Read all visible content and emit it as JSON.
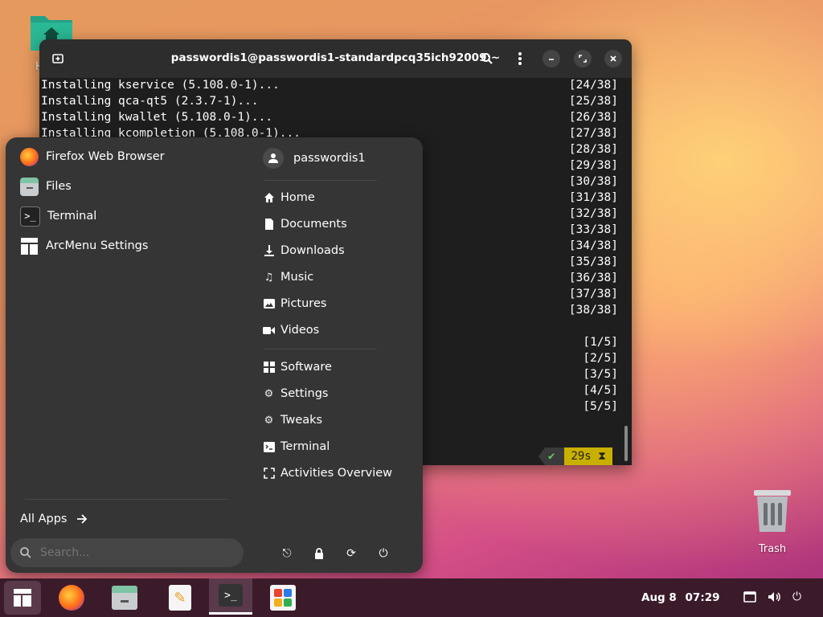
{
  "desktop": {
    "home_label": "H",
    "trash_label": "Trash"
  },
  "terminal": {
    "title": "passwordis1@passwordis1-standardpcq35ich92009:~",
    "lines": [
      "Installing kservice (5.108.0-1)...",
      "Installing qca-qt5 (2.3.7-1)...",
      "Installing kwallet (5.108.0-1)...",
      "Installing kcompletion (5.108.0-1)..."
    ],
    "counters": [
      "[24/38]",
      "[25/38]",
      "[26/38]",
      "[27/38]",
      "[28/38]",
      "[29/38]",
      "[30/38]",
      "[31/38]",
      "[32/38]",
      "[33/38]",
      "[34/38]",
      "[35/38]",
      "[36/38]",
      "[37/38]",
      "[38/38]"
    ],
    "counters2": [
      "[1/5]",
      "[2/5]",
      "[3/5]",
      "[4/5]",
      "[5/5]"
    ],
    "status_ok": "✔",
    "status_time": "29s ⧗"
  },
  "menu": {
    "apps": [
      "Firefox Web Browser",
      "Files",
      "Terminal",
      "ArcMenu Settings"
    ],
    "user": "passwordis1",
    "places": [
      "Home",
      "Documents",
      "Downloads",
      "Music",
      "Pictures",
      "Videos"
    ],
    "system": [
      "Software",
      "Settings",
      "Tweaks",
      "Terminal",
      "Activities Overview"
    ],
    "all_apps": "All Apps",
    "search_placeholder": "Search..."
  },
  "taskbar": {
    "date": "Aug 8",
    "time": "07:29"
  }
}
